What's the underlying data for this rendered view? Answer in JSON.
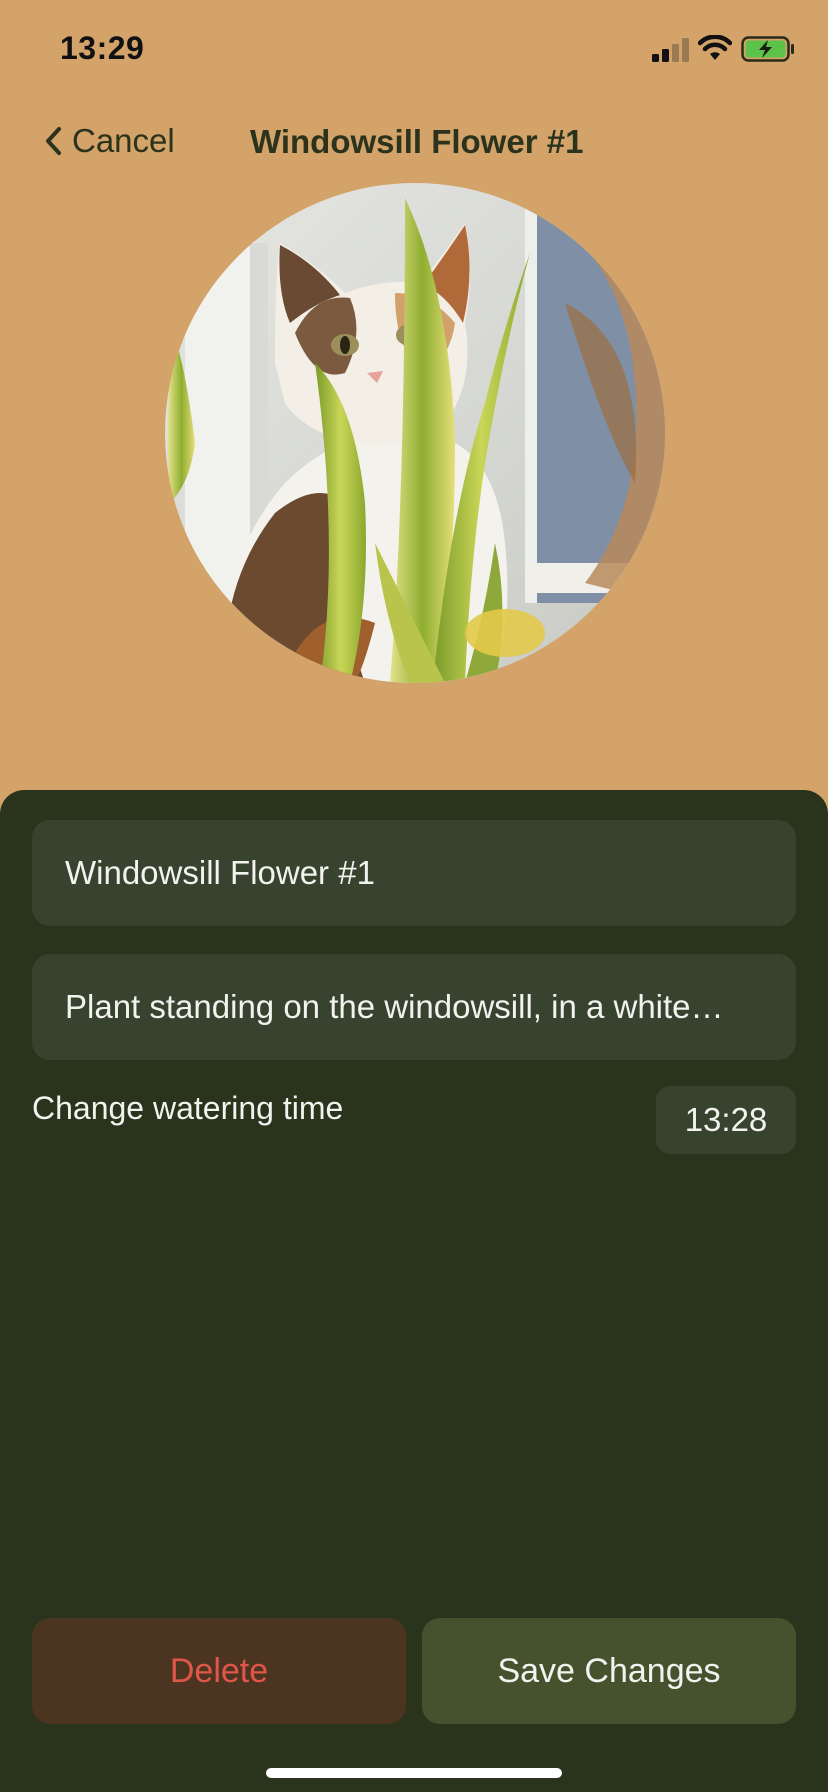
{
  "status_bar": {
    "time": "13:29",
    "icons": [
      "signal-icon",
      "wifi-icon",
      "battery-charging-icon"
    ]
  },
  "nav": {
    "back_label": "Cancel",
    "back_icon": "chevron-left-icon",
    "title": "Windowsill Flower #1"
  },
  "photo": {
    "subject": "plant-photo"
  },
  "form": {
    "name_value": "Windowsill Flower #1",
    "description_value": "Plant standing on the windowsill, in a white…",
    "watering_label": "Change watering time",
    "watering_time": "13:28"
  },
  "actions": {
    "delete_label": "Delete",
    "save_label": "Save Changes"
  },
  "colors": {
    "header_bg": "#d3a36a",
    "sheet_bg": "#2a331c",
    "field_bg": "#38432f",
    "delete_bg": "#4b3420",
    "delete_text": "#e2564a",
    "save_bg": "#46522e",
    "title_text": "#2b331d"
  }
}
